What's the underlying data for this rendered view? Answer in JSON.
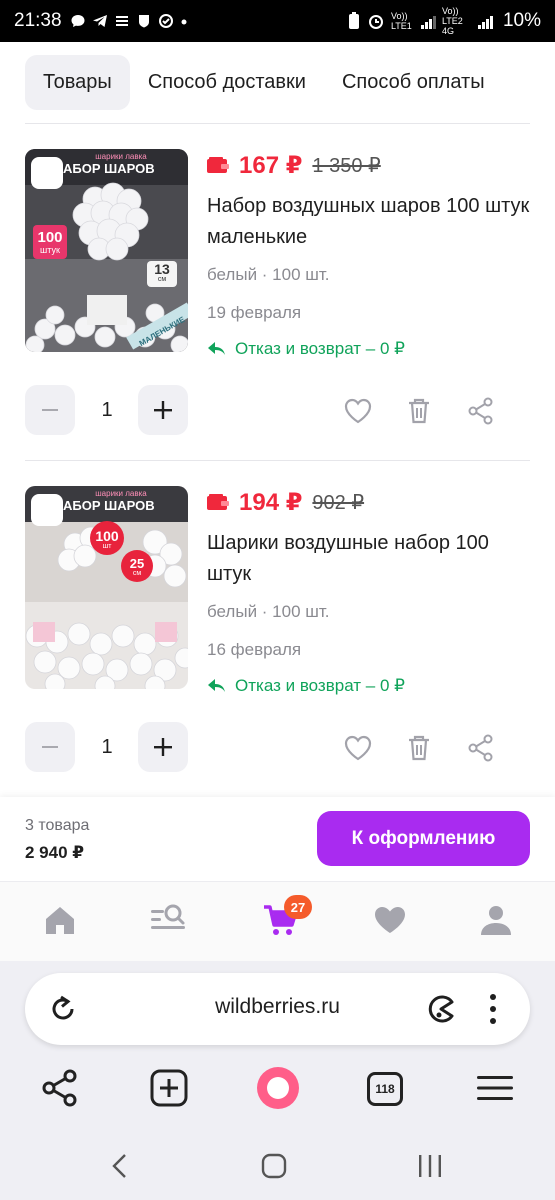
{
  "status_bar": {
    "time": "21:38",
    "net1": "Vo)) LTE1",
    "net2": "Vo)) LTE2 4G",
    "battery": "10%"
  },
  "tabs": [
    {
      "label": "Товары",
      "active": true
    },
    {
      "label": "Способ доставки",
      "active": false
    },
    {
      "label": "Способ оплаты",
      "active": false
    }
  ],
  "products": [
    {
      "price": "167 ₽",
      "old_price": "1 350 ₽",
      "title": "Набор воздушных шаров 100 штук маленькие",
      "variant": "белый · 100 шт.",
      "delivery": "19 февраля",
      "return_policy": "Отказ и возврат – 0 ₽",
      "quantity": "1",
      "thumb": {
        "header": "АБОР ШАРОВ",
        "brand": "шарики лавка",
        "count": "100",
        "count_unit": "штук",
        "size": "13",
        "size_unit": "см",
        "ribbon": "МАЛЕНЬКИЕ"
      }
    },
    {
      "price": "194 ₽",
      "old_price": "902 ₽",
      "title": "Шарики воздушные набор 100 штук",
      "variant": "белый · 100 шт.",
      "delivery": "16 февраля",
      "return_policy": "Отказ и возврат – 0 ₽",
      "quantity": "1",
      "thumb": {
        "header": "АБОР ШАРОВ",
        "brand": "шарики лавка",
        "count": "100",
        "count_unit": "шт",
        "size": "25",
        "size_unit": "см"
      }
    }
  ],
  "checkout": {
    "count_label": "3 товара",
    "total": "2 940 ₽",
    "button_label": "К оформлению"
  },
  "bottom_nav": {
    "items": [
      "home-icon",
      "catalog-search-icon",
      "cart-icon",
      "favorites-icon",
      "profile-icon"
    ],
    "cart_badge": "27"
  },
  "browser": {
    "url": "wildberries.ru",
    "tabs_count": "118"
  },
  "colors": {
    "price_red": "#f0283c",
    "accent_purple": "#a92bf0",
    "return_green": "#10a35a",
    "badge_orange": "#f55b2b"
  }
}
